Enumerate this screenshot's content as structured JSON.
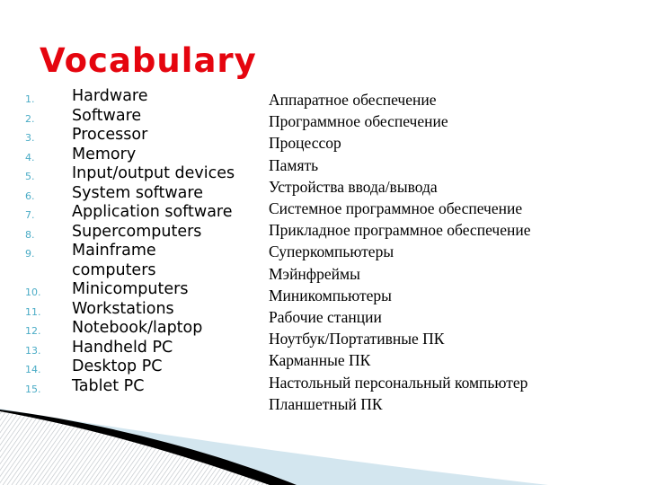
{
  "slide": {
    "title": "Vocabulary",
    "colors": {
      "title": "#e5050f",
      "list_number": "#4bacc6",
      "decor_light_blue": "#d3e6ef",
      "decor_black": "#000000"
    },
    "english_terms": [
      {
        "num": "1.",
        "term": "Hardware"
      },
      {
        "num": "2.",
        "term": "Software"
      },
      {
        "num": "3.",
        "term": "Processor"
      },
      {
        "num": "4.",
        "term": "Memory"
      },
      {
        "num": "5.",
        "term": "Input/output devices"
      },
      {
        "num": "6.",
        "term": "System software"
      },
      {
        "num": "7.",
        "term": "Application software"
      },
      {
        "num": "8.",
        "term": "Supercomputers"
      },
      {
        "num": "9.",
        "term": "Mainframe computers"
      },
      {
        "num": "10.",
        "term": "Minicomputers"
      },
      {
        "num": "11.",
        "term": "Workstations"
      },
      {
        "num": "12.",
        "term": "Notebook/laptop"
      },
      {
        "num": "13.",
        "term": "Handheld PC"
      },
      {
        "num": "14.",
        "term": "Desktop  PC"
      },
      {
        "num": "15.",
        "term": "Tablet PC"
      }
    ],
    "russian_terms": [
      "Аппаратное обеспечение",
      "Программное обеспечение",
      "Процессор",
      "Память",
      "Устройства ввода/вывода",
      "Системное программное обеспечение",
      "Прикладное программное обеспечение",
      "Суперкомпьютеры",
      "Мэйнфреймы",
      "Миникомпьютеры",
      "Рабочие станции",
      "Ноутбук/Портативные ПК",
      "Карманные ПК",
      "Настольный персональный компьютер",
      "Планшетный ПК"
    ]
  }
}
